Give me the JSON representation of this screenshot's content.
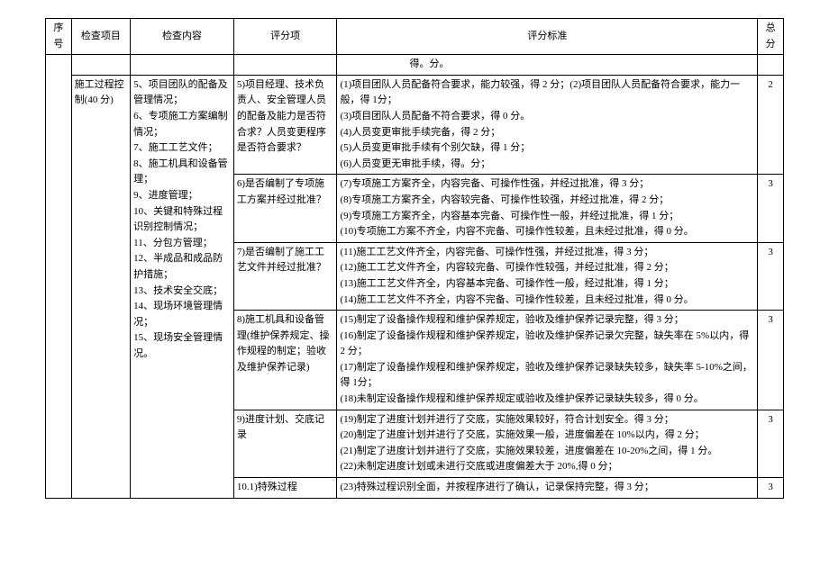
{
  "headers": {
    "seq": "序号",
    "project": "检查项目",
    "content": "检查内容",
    "item": "评分项",
    "criteria": "评分标准",
    "total": "总分"
  },
  "topCriteria": "得。分。",
  "projectLabel": "施工过程控制(40 分)",
  "contentText": "5、项目团队的配备及管理情况；\n6、专项施工方案编制情况；\n7、施工工艺文件；\n8、施工机具和设备管理；\n9、进度管理；\n10、关键和特殊过程识别控制情况；\n11、分包方管理；\n12、半成品和成品防护措施；\n13、技术安全交底；\n14、现场环境管理情况；\n15、现场安全管理情况。",
  "rows": [
    {
      "item": "5)项目经理、技术负责人、安全管理人员的配备及能力是否符合求？人员变更程序是否符合要求？",
      "criteria": "(1)项目团队人员配备符合要求，能力较强，得 2 分；(2)项目团队人员配备符合要求，能力一般，得 1分；\n(3)项目团队人员配备不符合要求，得 0 分。\n(4)人员变更审批手续完备，得 2 分；\n(5)人员变更审批手续有个别欠缺，得 1 分；\n(6)人员变更无审批手续，得。分；",
      "score": "2"
    },
    {
      "item": "6)是否编制了专项施工方案并经过批准？",
      "criteria": "(7)专项施工方案齐全，内容完备、可操作性强，并经过批准，得 3 分；\n(8)专项施工方案齐全，内容较完备、可操作性较强，并经过批准，得 2 分；\n(9)专项施工方案齐全，内容基本完备、可操作性一般，并经过批准，得 1 分；\n(10)专项施工方案不齐全，内容不完备、可操作性较差，且未经过批准，得 0 分。",
      "score": "3"
    },
    {
      "item": "7)是否编制了施工工艺文件并经过批准？",
      "criteria": "(11)施工工艺文件齐全，内容完备、可操作性强，并经过批准，得 3 分；\n(12)施工工艺文件齐全，内容较完备、可操作性较强，并经过批准，得 2 分；\n(13)施工工艺文件齐全，内容基本完备、可操作性一般，经过批准，得 1 分；\n(14)施工工艺文件不齐全，内容不完备、可操作性较差，且未经过批准，得 0 分。",
      "score": "3"
    },
    {
      "item": "8)施工机具和设备管理(维护保养规定、操作规程的制定；验收及维护保养记录)",
      "criteria": "(15)制定了设备操作规程和维护保养规定，验收及维护保养记录完整，得 3 分；\n(16)制定了设备操作规程和维护保养规定，验收及维护保养记录欠完整，缺失率在 5%以内，得 2 分；\n(17)制定了设备操作规程和维护保养规定，验收及维护保养记录缺失较多，缺失率 5-10%之间，得 1分；\n(18)未制定设备操作规程和维护保养规定或验收及维护保养记录缺失较多，得 0 分。",
      "score": "3"
    },
    {
      "item": "9)进度计划、交底记录",
      "criteria": "(19)制定了进度计划并进行了交底，实施效果较好，符合计划安全。得 3 分；\n(20)制定了进度计划并进行了交底，实施效果一般，进度偏差在 10%以内，得 2 分；\n(21)制定了进度计划并进行了交底，实施效果较差，进度偏差在 10-20%之间，得 1 分。\n(22)未制定进度计划或未进行交底或进度偏差大于 20%,得 0 分；",
      "score": "3"
    },
    {
      "item": "10.1)特殊过程",
      "criteria": "(23)特殊过程识别全面，并按程序进行了确认，记录保持完整，得 3 分；",
      "score": "3"
    }
  ]
}
